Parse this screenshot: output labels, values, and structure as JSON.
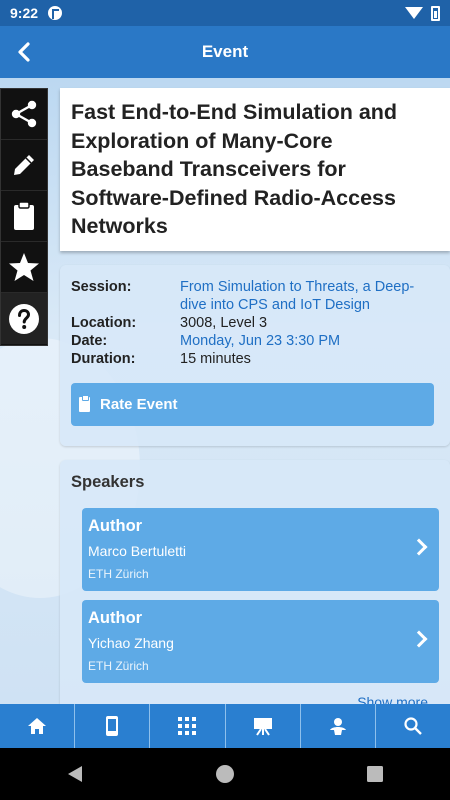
{
  "status_bar": {
    "time": "9:22"
  },
  "app_bar": {
    "title": "Event",
    "back_icon": "chevron-left-icon"
  },
  "side_menu": {
    "items": [
      {
        "name": "share",
        "icon": "share-icon"
      },
      {
        "name": "edit",
        "icon": "pencil-icon"
      },
      {
        "name": "notes",
        "icon": "clipboard-icon"
      },
      {
        "name": "favorite",
        "icon": "star-icon"
      },
      {
        "name": "help",
        "icon": "help-icon"
      }
    ]
  },
  "event": {
    "title": "Fast End-to-End Simulation and Exploration of Many-Core Baseband Transceivers for Software-Defined Radio-Access Networks",
    "details": {
      "session_label": "Session:",
      "session_value": "From Simulation to Threats, a Deep-dive into CPS and IoT Design",
      "location_label": "Location:",
      "location_value": "3008, Level 3",
      "date_label": "Date:",
      "date_value": "Monday, Jun 23 3:30 PM",
      "duration_label": "Duration:",
      "duration_value": "15 minutes"
    },
    "rate_button_label": "Rate Event"
  },
  "speakers": {
    "heading": "Speakers",
    "items": [
      {
        "role": "Author",
        "name": "Marco Bertuletti",
        "org": "ETH Zürich"
      },
      {
        "role": "Author",
        "name": "Yichao Zhang",
        "org": "ETH Zürich"
      }
    ],
    "show_more_label": "Show more"
  },
  "bottom_nav": {
    "items": [
      {
        "name": "home",
        "icon": "home-icon"
      },
      {
        "name": "device",
        "icon": "phone-icon"
      },
      {
        "name": "apps",
        "icon": "grid-icon"
      },
      {
        "name": "presentation",
        "icon": "easel-icon"
      },
      {
        "name": "people",
        "icon": "person-icon"
      },
      {
        "name": "search",
        "icon": "search-icon"
      }
    ]
  },
  "colors": {
    "status_bar": "#1f62a8",
    "app_bar": "#2a78c6",
    "accent_button": "#5eaae6",
    "link": "#1f6fc4",
    "bottom_nav": "#2a7fd0"
  }
}
